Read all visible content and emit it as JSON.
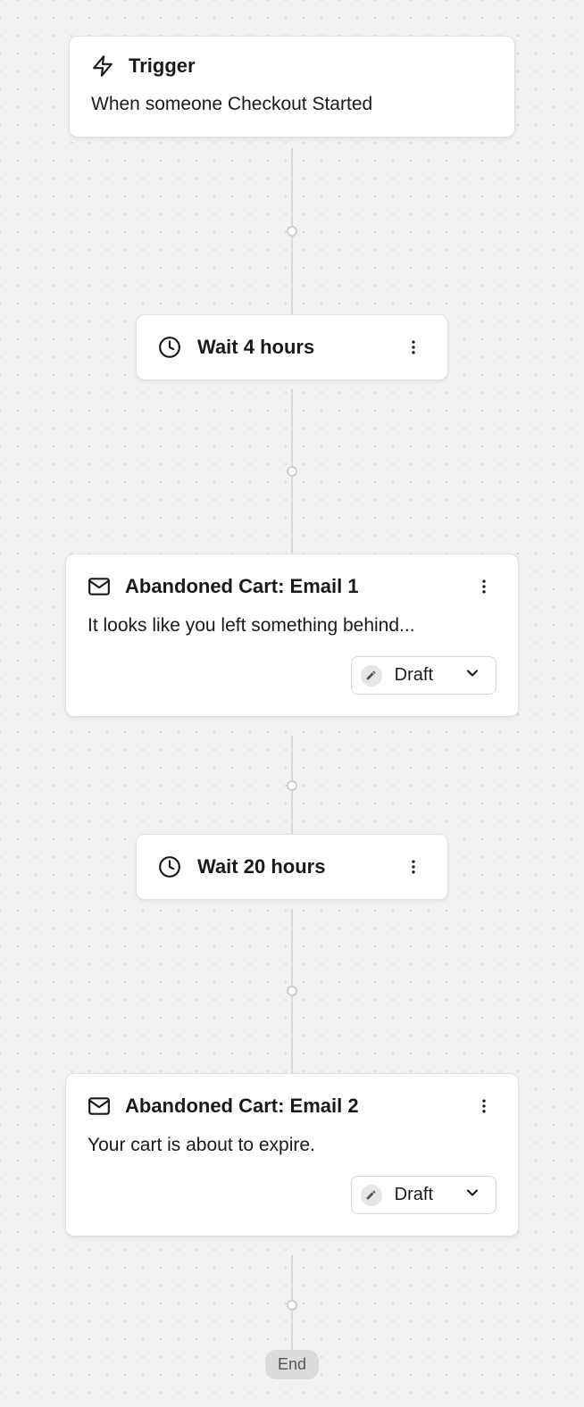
{
  "trigger": {
    "title": "Trigger",
    "description": "When someone Checkout Started"
  },
  "nodes": [
    {
      "type": "wait",
      "label": "Wait 4 hours"
    },
    {
      "type": "email",
      "title": "Abandoned Cart: Email 1",
      "desc": "It looks like you left something behind...",
      "status": "Draft"
    },
    {
      "type": "wait",
      "label": "Wait 20 hours"
    },
    {
      "type": "email",
      "title": "Abandoned Cart: Email 2",
      "desc": "Your cart is about to expire.",
      "status": "Draft"
    }
  ],
  "end_label": "End"
}
